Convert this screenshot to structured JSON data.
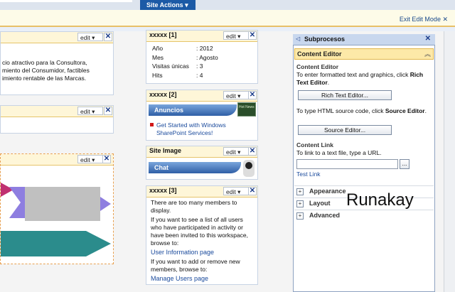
{
  "topbar": {
    "site_actions": "Site Actions ▾"
  },
  "editbar": {
    "exit": "Exit Edit Mode ✕"
  },
  "left": {
    "wp1": {
      "edit": "edit ▾",
      "close": "✕",
      "lines": [
        "cio atractivo para la Consultora,",
        "miento del Consumidor, factibles",
        "imiento rentable de las Marcas."
      ]
    },
    "wp2": {
      "edit": "edit ▾",
      "close": "✕"
    },
    "wp3": {
      "edit": "edit ▾",
      "close": "✕"
    }
  },
  "middle": {
    "wp1": {
      "title": "xxxxx [1]",
      "edit": "edit ▾",
      "close": "✕",
      "rows": [
        {
          "label": "Año",
          "value": ": 2012"
        },
        {
          "label": "Mes",
          "value": ": Agosto"
        },
        {
          "label": "Visitas únicas",
          "value": ": 3"
        },
        {
          "label": "Hits",
          "value": ": 4"
        }
      ]
    },
    "wp2": {
      "title": "xxxxx [2]",
      "edit": "edit ▾",
      "close": "✕",
      "banner": "Anuncios",
      "link": "Get Started with Windows SharePoint Services!",
      "badge": "Hot News"
    },
    "wp3": {
      "title": "Site Image",
      "edit": "edit ▾",
      "close": "✕",
      "banner": "Chat"
    },
    "wp4": {
      "title": "xxxxx [3]",
      "edit": "edit ▾",
      "close": "✕",
      "p1": "There are too many members to display.",
      "p2": "If you want to see a list of all users who have participated in activity or have been invited to this workspace, browse to:",
      "link1": "User Information page",
      "p3": "If you want to add or remove new members, browse to:",
      "link2": "Manage Users page"
    }
  },
  "pane": {
    "title": "Subprocesos",
    "close": "✕",
    "section": "Content Editor",
    "ce_heading": "Content Editor",
    "ce_text": "To enter formatted text and graphics, click ",
    "ce_text_bold": "Rich Text Editor",
    "ce_button": "Rich Text Editor...",
    "src_text": "To type HTML source code, click ",
    "src_text_bold": "Source Editor",
    "src_button": "Source Editor...",
    "link_heading": "Content Link",
    "link_text": "To link to a text file, type a URL.",
    "browse": "...",
    "test_link": "Test Link",
    "sections": [
      "Appearance",
      "Layout",
      "Advanced"
    ],
    "watermark": "Runakay"
  }
}
